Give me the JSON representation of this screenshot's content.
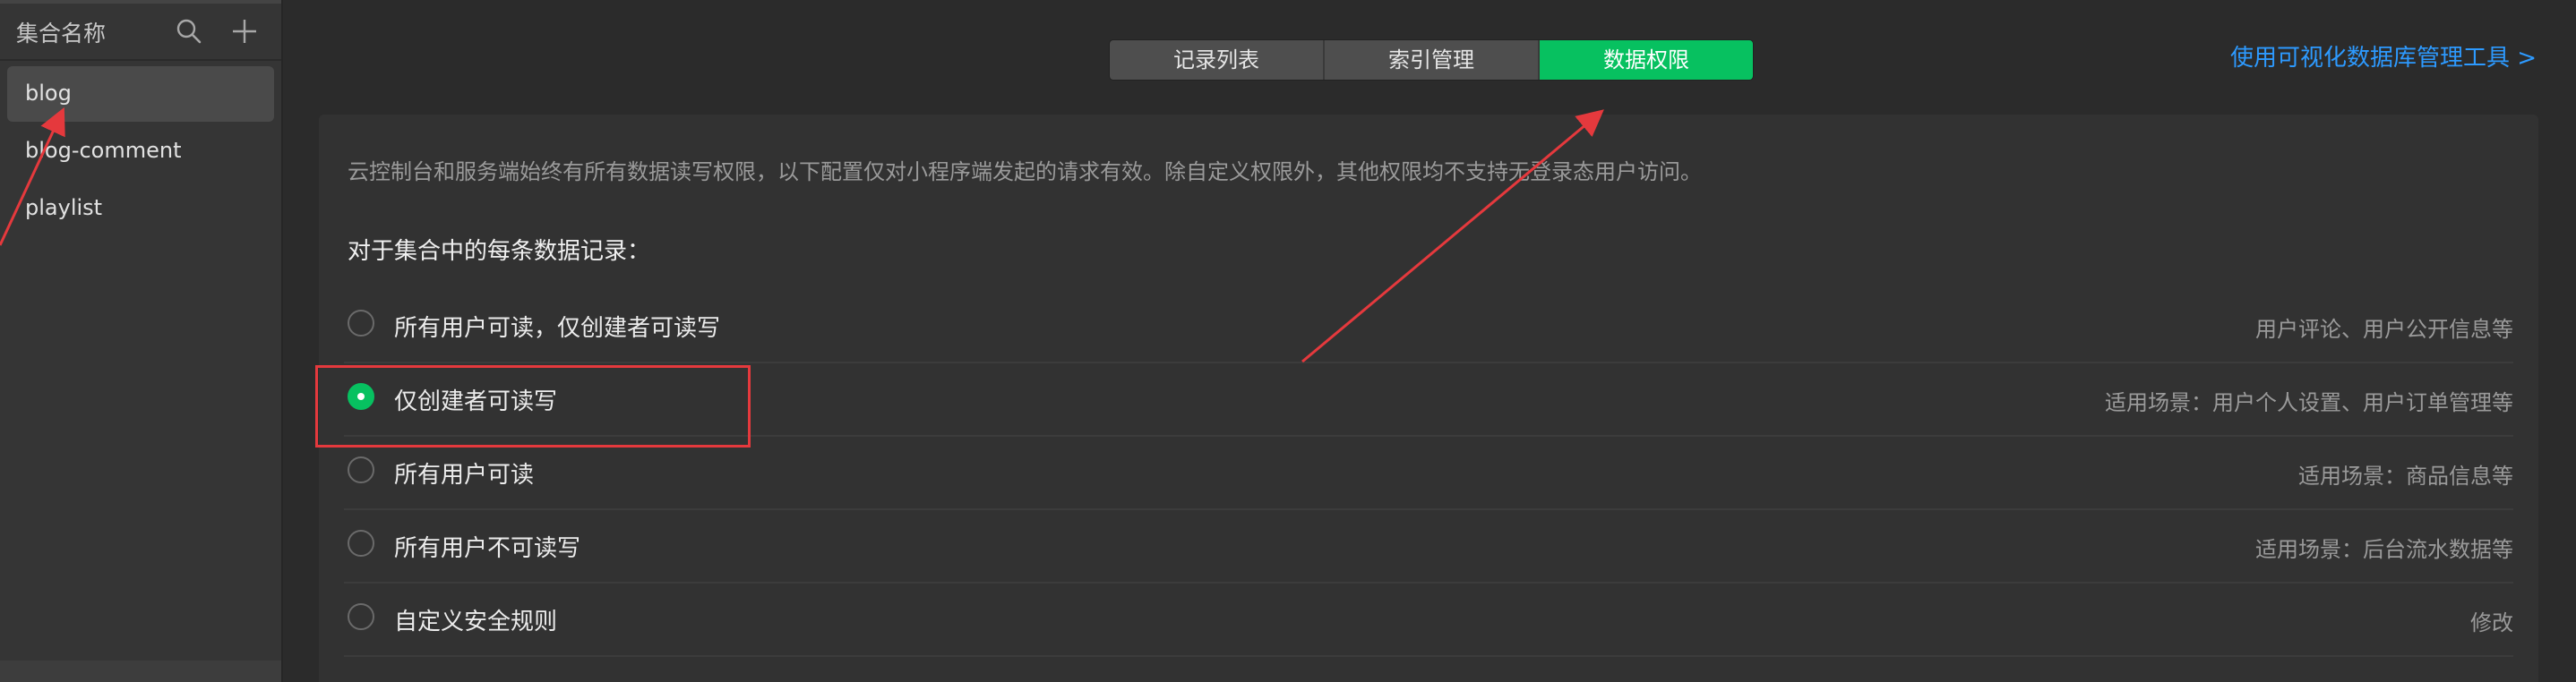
{
  "sidebar": {
    "title": "集合名称",
    "search_icon": "search-icon",
    "add_icon": "plus-icon",
    "items": [
      {
        "label": "blog",
        "active": true
      },
      {
        "label": "blog-comment",
        "active": false
      },
      {
        "label": "playlist",
        "active": false
      }
    ]
  },
  "tabs": [
    {
      "label": "记录列表",
      "active": false
    },
    {
      "label": "索引管理",
      "active": false
    },
    {
      "label": "数据权限",
      "active": true
    }
  ],
  "top_link": "使用可视化数据库管理工具 >",
  "panel": {
    "notice": "云控制台和服务端始终有所有数据读写权限，以下配置仅对小程序端发起的请求有效。除自定义权限外，其他权限均不支持无登录态用户访问。",
    "section_title": "对于集合中的每条数据记录：",
    "options": [
      {
        "label": "所有用户可读，仅创建者可读写",
        "hint": "用户评论、用户公开信息等",
        "selected": false
      },
      {
        "label": "仅创建者可读写",
        "hint": "适用场景：用户个人设置、用户订单管理等",
        "selected": true
      },
      {
        "label": "所有用户可读",
        "hint": "适用场景：商品信息等",
        "selected": false
      },
      {
        "label": "所有用户不可读写",
        "hint": "适用场景：后台流水数据等",
        "selected": false
      },
      {
        "label": "自定义安全规则",
        "hint": "修改",
        "selected": false
      }
    ]
  },
  "colors": {
    "accent": "#07c160",
    "link": "#2d9aff",
    "annotation": "#e5393d",
    "background": "#2b2b2b",
    "sidebar": "#353535",
    "panel": "#323232"
  }
}
